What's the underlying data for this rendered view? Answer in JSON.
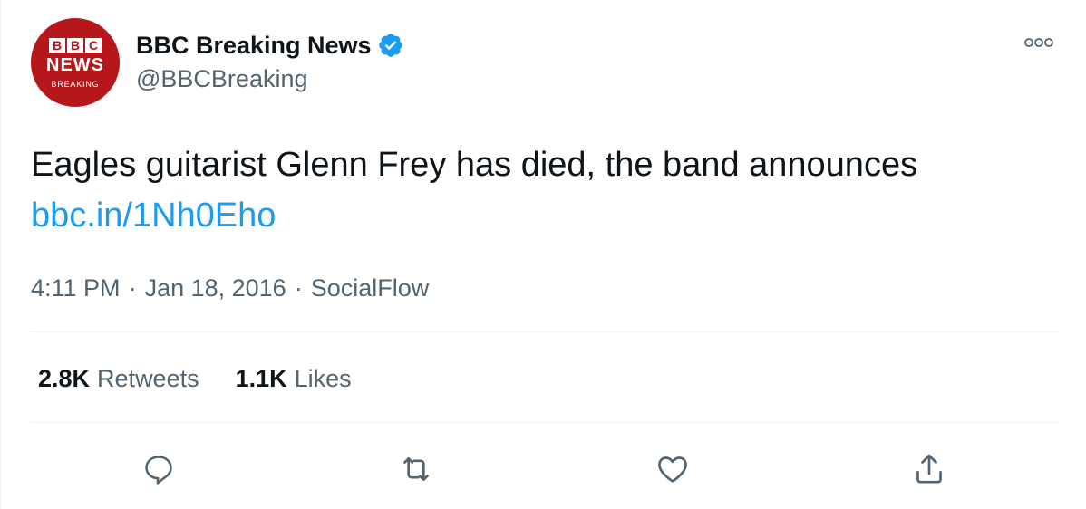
{
  "account": {
    "display_name": "BBC Breaking News",
    "handle": "@BBCBreaking",
    "verified": true,
    "avatar": {
      "line1": [
        "B",
        "B",
        "C"
      ],
      "line2": "NEWS",
      "line3": "BREAKING",
      "background_color": "#b5171b"
    }
  },
  "tweet": {
    "text": "Eagles guitarist Glenn Frey has died, the band announces",
    "link_text": "bbc.in/1Nh0Eho",
    "time": "4:11 PM",
    "date": "Jan 18, 2016",
    "source": "SocialFlow",
    "separator": "·"
  },
  "stats": {
    "retweets_count": "2.8K",
    "retweets_label": "Retweets",
    "likes_count": "1.1K",
    "likes_label": "Likes"
  },
  "actions": [
    {
      "icon": "reply-icon"
    },
    {
      "icon": "retweet-icon"
    },
    {
      "icon": "like-icon"
    },
    {
      "icon": "share-icon"
    }
  ],
  "colors": {
    "text_primary": "#0f1419",
    "text_secondary": "#536471",
    "link": "#1d9bf0",
    "verified_badge": "#1d9bf0",
    "divider": "#eff3f4"
  }
}
